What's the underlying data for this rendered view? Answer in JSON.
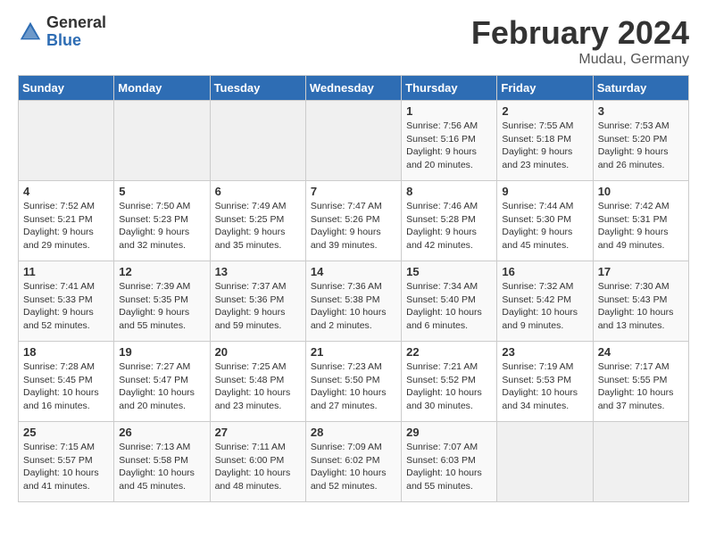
{
  "logo": {
    "general": "General",
    "blue": "Blue"
  },
  "title": {
    "month_year": "February 2024",
    "location": "Mudau, Germany"
  },
  "headers": [
    "Sunday",
    "Monday",
    "Tuesday",
    "Wednesday",
    "Thursday",
    "Friday",
    "Saturday"
  ],
  "weeks": [
    [
      {
        "day": "",
        "info": ""
      },
      {
        "day": "",
        "info": ""
      },
      {
        "day": "",
        "info": ""
      },
      {
        "day": "",
        "info": ""
      },
      {
        "day": "1",
        "info": "Sunrise: 7:56 AM\nSunset: 5:16 PM\nDaylight: 9 hours\nand 20 minutes."
      },
      {
        "day": "2",
        "info": "Sunrise: 7:55 AM\nSunset: 5:18 PM\nDaylight: 9 hours\nand 23 minutes."
      },
      {
        "day": "3",
        "info": "Sunrise: 7:53 AM\nSunset: 5:20 PM\nDaylight: 9 hours\nand 26 minutes."
      }
    ],
    [
      {
        "day": "4",
        "info": "Sunrise: 7:52 AM\nSunset: 5:21 PM\nDaylight: 9 hours\nand 29 minutes."
      },
      {
        "day": "5",
        "info": "Sunrise: 7:50 AM\nSunset: 5:23 PM\nDaylight: 9 hours\nand 32 minutes."
      },
      {
        "day": "6",
        "info": "Sunrise: 7:49 AM\nSunset: 5:25 PM\nDaylight: 9 hours\nand 35 minutes."
      },
      {
        "day": "7",
        "info": "Sunrise: 7:47 AM\nSunset: 5:26 PM\nDaylight: 9 hours\nand 39 minutes."
      },
      {
        "day": "8",
        "info": "Sunrise: 7:46 AM\nSunset: 5:28 PM\nDaylight: 9 hours\nand 42 minutes."
      },
      {
        "day": "9",
        "info": "Sunrise: 7:44 AM\nSunset: 5:30 PM\nDaylight: 9 hours\nand 45 minutes."
      },
      {
        "day": "10",
        "info": "Sunrise: 7:42 AM\nSunset: 5:31 PM\nDaylight: 9 hours\nand 49 minutes."
      }
    ],
    [
      {
        "day": "11",
        "info": "Sunrise: 7:41 AM\nSunset: 5:33 PM\nDaylight: 9 hours\nand 52 minutes."
      },
      {
        "day": "12",
        "info": "Sunrise: 7:39 AM\nSunset: 5:35 PM\nDaylight: 9 hours\nand 55 minutes."
      },
      {
        "day": "13",
        "info": "Sunrise: 7:37 AM\nSunset: 5:36 PM\nDaylight: 9 hours\nand 59 minutes."
      },
      {
        "day": "14",
        "info": "Sunrise: 7:36 AM\nSunset: 5:38 PM\nDaylight: 10 hours\nand 2 minutes."
      },
      {
        "day": "15",
        "info": "Sunrise: 7:34 AM\nSunset: 5:40 PM\nDaylight: 10 hours\nand 6 minutes."
      },
      {
        "day": "16",
        "info": "Sunrise: 7:32 AM\nSunset: 5:42 PM\nDaylight: 10 hours\nand 9 minutes."
      },
      {
        "day": "17",
        "info": "Sunrise: 7:30 AM\nSunset: 5:43 PM\nDaylight: 10 hours\nand 13 minutes."
      }
    ],
    [
      {
        "day": "18",
        "info": "Sunrise: 7:28 AM\nSunset: 5:45 PM\nDaylight: 10 hours\nand 16 minutes."
      },
      {
        "day": "19",
        "info": "Sunrise: 7:27 AM\nSunset: 5:47 PM\nDaylight: 10 hours\nand 20 minutes."
      },
      {
        "day": "20",
        "info": "Sunrise: 7:25 AM\nSunset: 5:48 PM\nDaylight: 10 hours\nand 23 minutes."
      },
      {
        "day": "21",
        "info": "Sunrise: 7:23 AM\nSunset: 5:50 PM\nDaylight: 10 hours\nand 27 minutes."
      },
      {
        "day": "22",
        "info": "Sunrise: 7:21 AM\nSunset: 5:52 PM\nDaylight: 10 hours\nand 30 minutes."
      },
      {
        "day": "23",
        "info": "Sunrise: 7:19 AM\nSunset: 5:53 PM\nDaylight: 10 hours\nand 34 minutes."
      },
      {
        "day": "24",
        "info": "Sunrise: 7:17 AM\nSunset: 5:55 PM\nDaylight: 10 hours\nand 37 minutes."
      }
    ],
    [
      {
        "day": "25",
        "info": "Sunrise: 7:15 AM\nSunset: 5:57 PM\nDaylight: 10 hours\nand 41 minutes."
      },
      {
        "day": "26",
        "info": "Sunrise: 7:13 AM\nSunset: 5:58 PM\nDaylight: 10 hours\nand 45 minutes."
      },
      {
        "day": "27",
        "info": "Sunrise: 7:11 AM\nSunset: 6:00 PM\nDaylight: 10 hours\nand 48 minutes."
      },
      {
        "day": "28",
        "info": "Sunrise: 7:09 AM\nSunset: 6:02 PM\nDaylight: 10 hours\nand 52 minutes."
      },
      {
        "day": "29",
        "info": "Sunrise: 7:07 AM\nSunset: 6:03 PM\nDaylight: 10 hours\nand 55 minutes."
      },
      {
        "day": "",
        "info": ""
      },
      {
        "day": "",
        "info": ""
      }
    ]
  ]
}
